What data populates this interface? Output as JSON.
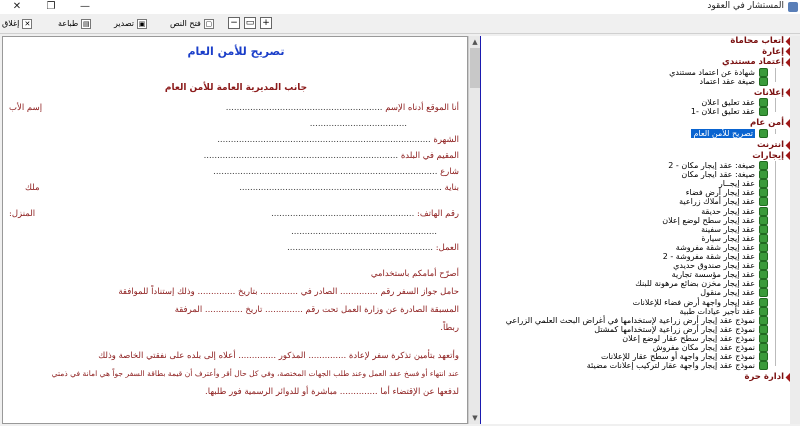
{
  "window": {
    "title": "المستشار في العقود",
    "minimize": "—",
    "maximize": "❐",
    "close": "✕"
  },
  "toolbar": {
    "close_label": "إغلاق",
    "print_label": "طباعة",
    "export_label": "تصدير",
    "open_text_label": "فتح النص",
    "minus_label": "−",
    "restore_label": "▭",
    "plus_label": "+"
  },
  "document": {
    "title": "تصريح للأمن العام",
    "subtitle": "جانب المديرية العامة للأمن العام",
    "lines": [
      {
        "label": "أنا الموقع أدناه الإسم",
        "dots": "..........................................................",
        "right_label": "إسم الأب"
      },
      {
        "dots": "...................................."
      },
      {
        "label": "الشهرة",
        "dots": "..............................................................................."
      },
      {
        "label": "المقيم في البلدة",
        "dots": "........................................................................"
      },
      {
        "label": "شارع",
        "dots": "..................................................................................."
      },
      {
        "label": "بناية",
        "dots": "...........................................................................",
        "right_label": "ملك"
      },
      {
        "label": "رقم الهاتف:",
        "dots": ".....................................................",
        "right_label": "المنزل:"
      },
      {
        "dots": "......................................................"
      },
      {
        "label": "العمل:",
        "dots": "......................................................"
      }
    ],
    "body": [
      "أصرّح أمامكم باستخدامي",
      "حامل جواز السفر رقم .............. الصادر في .............. بتاريخ .............. وذلك إستناداً للموافقة",
      "المسبقة الصادرة عن وزارة العمل تحت رقم .............. تاريخ .............. المرفقة",
      "ربطاً.",
      "وأتعهد بتأمين تذكرة سفر لإعادة .............. المذكور .............. أعلاه إلى بلده على نفقتي الخاصة وذلك",
      "عند انتهاء أو فسخ عقد العمل وعند طلب الجهات المختصة، وفي كل حال أقر وأعترف أن قيمة بطاقة السفر جواً هي امانة في ذمتي",
      "لدفعها عن الإقتضاء أما .............. مباشرة أو للدوائر الرسمية فور طلبها."
    ]
  },
  "tree": {
    "categories": [
      {
        "label": "أتعاب محاماة",
        "leaves": []
      },
      {
        "label": "إعارة",
        "leaves": []
      },
      {
        "label": "إعتماد مستندي",
        "leaves": [
          "شهادة عن اعتماد مستندي",
          "صيغة عقد اعتماد"
        ]
      },
      {
        "label": "إعلانات",
        "leaves": [
          "عقد تعليق اعلان",
          "عقد تعليق اعلان -1"
        ]
      },
      {
        "label": "أمن عام",
        "leaves": [
          "تصريح للأمن العام"
        ]
      },
      {
        "label": "انترنت",
        "leaves": []
      },
      {
        "label": "إيجارات",
        "leaves": [
          "صيغة: عقد إيجار مكان - 2",
          "صيغة: عقد ايجار مكان",
          "عقد إيجــار",
          "عقد إيجار أرض فضاء",
          "عقد إيجار أملاك زراعية",
          "عقد إيجار حديقة",
          "عقد إيجار سطح لوضع إعلان",
          "عقد إيجار سفينة",
          "عقد إيجار سيارة",
          "عقد إيجار شقة مفروشة",
          "عقد إيجار شقة مفروشة - 2",
          "عقد إيجار صندوق حديدي",
          "عقد إيجار مؤسسة تجارية",
          "عقد إيجار مخزن بضائع مرهونة للبنك",
          "عقد إيجار منقول",
          "عقد إيجار واجهة أرض فضاء للإعلانات",
          "عقد تأجير عيادات طبية",
          "نموذج عقد إيجار أرض زراعية لإستخدامها في أغراض البحث العلمي الزراعي",
          "نموذج عقد إيجار أرض زراعية لإستخدامها كمشتل",
          "نموذج عقد إيجار سطح عقار لوضع إعلان",
          "نموذج عقد إيجار مكان مفروش",
          "نموذج عقد إيجار واجهة أو سطح عقار للإعلانات",
          "نموذج عقد إيجار واجهة عقار لتركيب إعلانات مضيئة"
        ]
      },
      {
        "label": "ادارة حرة",
        "leaves": []
      }
    ],
    "selected": "تصريح للأمن العام"
  },
  "colors": {
    "selection": "#0a64d0",
    "category": "#7a1010",
    "doc_title": "#1a3ec9",
    "tree_border": "#1a1ab0"
  }
}
